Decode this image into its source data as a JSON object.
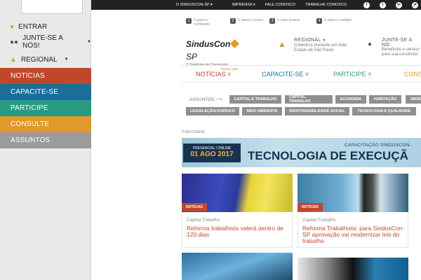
{
  "drawer": {
    "entrar": "ENTRAR",
    "junte": "JUNTE-SE A NÓS!",
    "regional": "REGIONAL",
    "categories": [
      {
        "label": "NOTÍCIAS",
        "color": "#c1472b"
      },
      {
        "label": "CAPACITE-SE",
        "color": "#1a6e99"
      },
      {
        "label": "PARTICIPE",
        "color": "#2a9a83"
      },
      {
        "label": "CONSULTE",
        "color": "#e09a2a"
      },
      {
        "label": "ASSUNTOS",
        "color": "#9b9b9b"
      }
    ]
  },
  "topbar": {
    "o_sinduscon": "O SINDUSCON-SP",
    "imprensa": "IMPRENSA",
    "fale": "FALE CONOSCO",
    "trabalhe": "TRABALHE CONOSCO",
    "socials": [
      "f",
      "t",
      "in",
      "yt"
    ]
  },
  "skip": [
    {
      "num": "1",
      "label": "Ir para o\nconteúdo"
    },
    {
      "num": "2",
      "label": "Ir para o menu"
    },
    {
      "num": "3",
      "label": "Ir para busca"
    },
    {
      "num": "4",
      "label": "Ir para o rodapé"
    }
  ],
  "header": {
    "logo_name": "SindusCon",
    "logo_sp": "SP",
    "logo_sub": "O Sindicato da Construção",
    "logo_since": "Desde 1934",
    "regional_title": "REGIONAL",
    "regional_text": "Cobertura presente em todo\nEstado de São Paulo",
    "junte_title": "JUNTE-SE A NÓ",
    "junte_text": "Benefícios e serviço\npara sua construtor"
  },
  "mainnav": [
    {
      "label": "NOTÍCIAS",
      "color": "#c1472b"
    },
    {
      "label": "CAPACITE-SE",
      "color": "#1a6e99"
    },
    {
      "label": "PARTICIPE",
      "color": "#2a9a83"
    },
    {
      "label": "CONSU",
      "color": "#e09a2a"
    }
  ],
  "assuntos": {
    "label": "ASSUNTOS",
    "tags_row1": [
      "CAPITAL E TRABALHO",
      "CAPITAL-TRABALHO",
      "ECONOMIA",
      "HABITAÇÃO",
      "IMOBI"
    ],
    "tags_row2": [
      "LEGISLAÇÃO/JURÍDICO",
      "MEIO AMBIENTE",
      "RESPONSABILIDADE SOCIAL",
      "TECNOLOGIA E QUALIDADE"
    ]
  },
  "banner": {
    "publicidade": "PUBLICIDADE",
    "kicker": "CAPACITAÇÃO SINDUSCON-",
    "title": "TECNOLOGIA DE EXECUÇÃ",
    "mode": "PRESENCIAL / ONLINE",
    "date": "01 AGO 2017"
  },
  "cards": [
    {
      "badge": "NOTÍCIAS",
      "category": "Capital Trabalho",
      "title": "Reforma trabalhista valerá dentro de 120 dias"
    },
    {
      "badge": "NOTÍCIAS",
      "category": "Capital Trabalho",
      "title": "Reforma Trabalhista: para SindusCon-SP aprovação vai modernizar leis do trabalho"
    }
  ]
}
